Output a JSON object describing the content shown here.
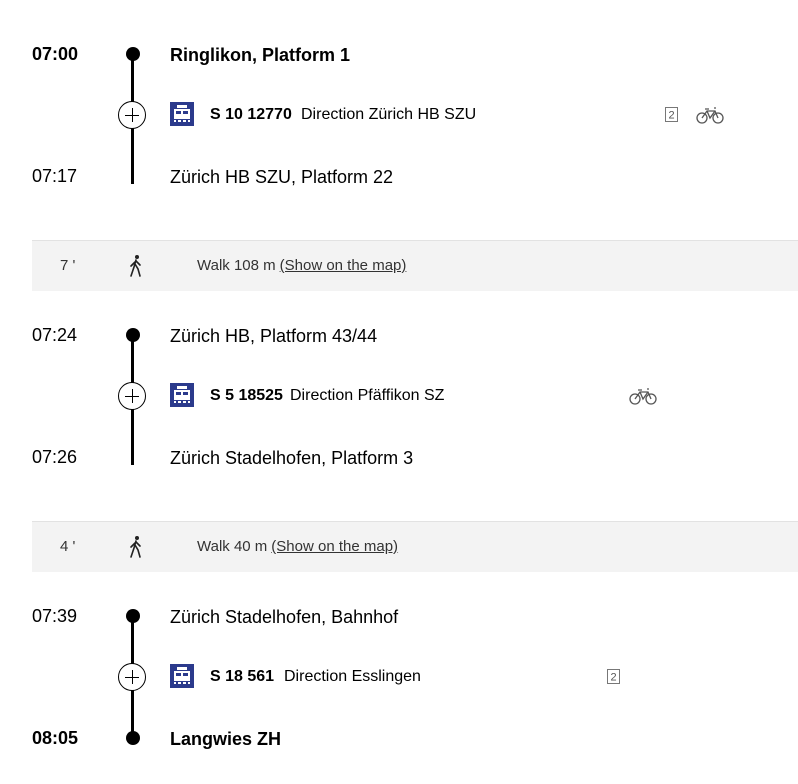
{
  "legs": [
    {
      "dep_time": "07:00",
      "dep_stop": "Ringlikon, Platform 1",
      "line": "S 10 12770",
      "direction": "Direction Zürich HB SZU",
      "arr_time": "07:17",
      "arr_stop": "Zürich HB SZU, Platform 22",
      "class_badge": "2",
      "bike": true
    },
    {
      "dep_time": "07:24",
      "dep_stop": "Zürich HB, Platform 43/44",
      "line": "S 5 18525",
      "direction": "Direction Pfäffikon SZ",
      "arr_time": "07:26",
      "arr_stop": "Zürich Stadelhofen, Platform 3",
      "bike": true
    },
    {
      "dep_time": "07:39",
      "dep_stop": "Zürich Stadelhofen, Bahnhof",
      "line": "S 18 561",
      "direction": "Direction Esslingen",
      "arr_time": "08:05",
      "arr_stop": "Langwies ZH",
      "class_badge": "2"
    }
  ],
  "walks": [
    {
      "minutes": "7 '",
      "text": "Walk 108 m",
      "link": "(Show on the map)"
    },
    {
      "minutes": "4 '",
      "text": "Walk 40 m",
      "link": "(Show on the map)"
    }
  ],
  "icons": {
    "transport": "train-icon",
    "walk": "pedestrian-icon",
    "bike": "bicycle-icon",
    "class": "second-class-icon",
    "expand": "plus-circle-icon"
  },
  "colors": {
    "train_icon_bg": "#2b3a8c",
    "walk_row_bg": "#f3f3f3"
  }
}
